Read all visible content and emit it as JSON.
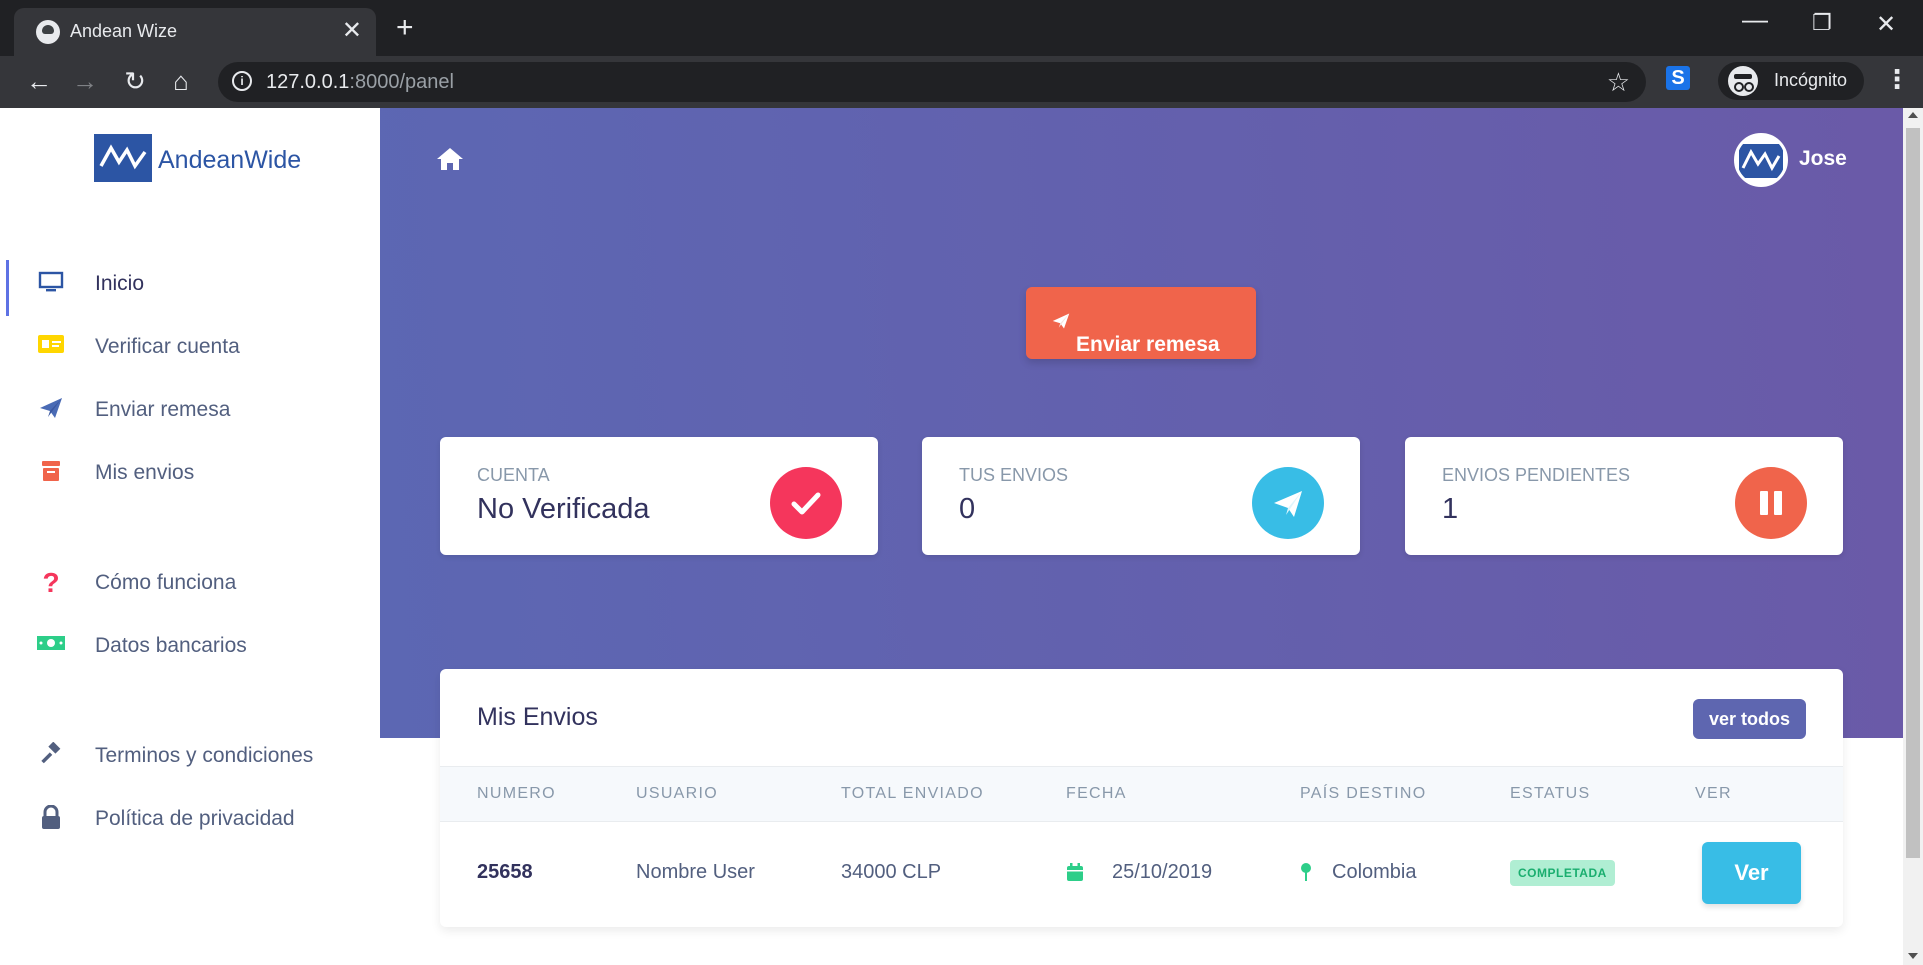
{
  "browser": {
    "tab_title": "Andean Wize",
    "url_host": "127.0.0.1",
    "url_path": ":8000/panel",
    "incognito_label": "Incógnito",
    "extension_letter": "S"
  },
  "sidebar": {
    "logo_text": "AndeanWide",
    "items": [
      {
        "label": "Inicio",
        "icon": "monitor-icon",
        "color": "#2c55a4"
      },
      {
        "label": "Verificar cuenta",
        "icon": "id-card-icon",
        "color": "#ffd600"
      },
      {
        "label": "Enviar remesa",
        "icon": "paper-plane-icon",
        "color": "#4a6bb5"
      },
      {
        "label": "Mis envios",
        "icon": "archive-icon",
        "color": "#f0644b"
      },
      {
        "label": "Cómo funciona",
        "icon": "question-icon",
        "color": "#f5365c"
      },
      {
        "label": "Datos bancarios",
        "icon": "money-icon",
        "color": "#2dce89"
      },
      {
        "label": "Terminos y condiciones",
        "icon": "gavel-icon",
        "color": "#525f7f"
      },
      {
        "label": "Política de privacidad",
        "icon": "lock-icon",
        "color": "#525f7f"
      }
    ]
  },
  "header": {
    "user_name": "Jose"
  },
  "hero": {
    "send_button_label": "Enviar remesa"
  },
  "stats": [
    {
      "title": "Cuenta",
      "value": "No Verificada",
      "icon": "check-icon",
      "color": "#f5365c"
    },
    {
      "title": "Tus envios",
      "value": "0",
      "icon": "paper-plane-icon",
      "color": "#38bde6"
    },
    {
      "title": "Envios pendientes",
      "value": "1",
      "icon": "pause-icon",
      "color": "#f0644b"
    }
  ],
  "table": {
    "title": "Mis Envios",
    "view_all_label": "ver todos",
    "columns": [
      "Numero",
      "Usuario",
      "Total enviado",
      "Fecha",
      "País destino",
      "Estatus",
      "Ver"
    ],
    "rows": [
      {
        "numero": "25658",
        "usuario": "Nombre User",
        "total": "34000 CLP",
        "fecha": "25/10/2019",
        "pais": "Colombia",
        "estatus": "COMPLETADA",
        "ver_label": "Ver"
      }
    ]
  },
  "colors": {
    "hero_start": "#5c67b3",
    "hero_end": "#6a5aa8",
    "accent": "#f0644b",
    "ver_button": "#38bde6",
    "status_success": "#1aae6f"
  }
}
